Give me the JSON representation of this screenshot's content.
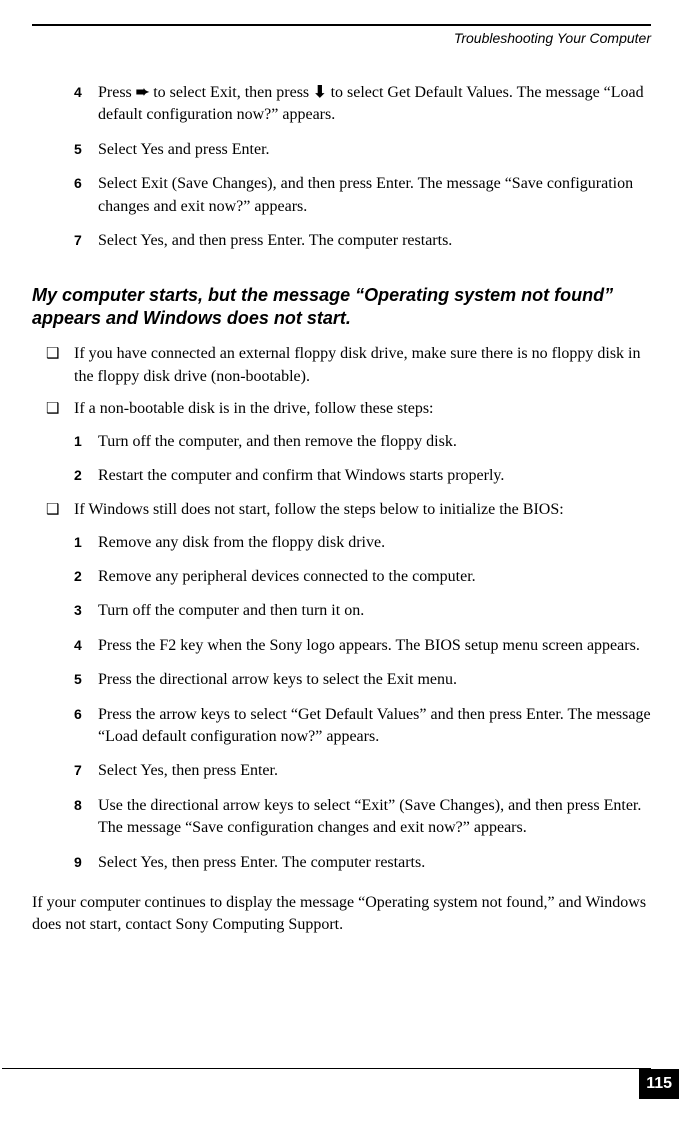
{
  "header": {
    "title": "Troubleshooting Your Computer"
  },
  "top_steps": [
    {
      "n": "4",
      "text_a": "Press ",
      "arrow1": "➨",
      "text_b": "   to select Exit, then press ",
      "arrow2": "⬇",
      "text_c": " to select Get Default Values. The message “Load default configuration now?” appears."
    },
    {
      "n": "5",
      "text": "Select Yes and press Enter."
    },
    {
      "n": "6",
      "text": "Select Exit (Save Changes), and then press Enter. The message “Save configuration changes and exit now?” appears."
    },
    {
      "n": "7",
      "text": "Select Yes, and then press Enter. The computer restarts."
    }
  ],
  "heading": "My computer starts, but the message “Operating system not found” appears and Windows does not start.",
  "bullets": [
    {
      "text": "If you have connected an external floppy disk drive, make sure there is no floppy disk in the floppy disk drive (non-bootable)."
    },
    {
      "text": "If a non-bootable disk is in the drive, follow these steps:",
      "steps": [
        {
          "n": "1",
          "text": "Turn off the computer, and then remove the floppy disk."
        },
        {
          "n": "2",
          "text": "Restart the computer and confirm that Windows starts properly."
        }
      ]
    },
    {
      "text": "If Windows still does not start, follow the steps below to initialize the BIOS:",
      "steps": [
        {
          "n": "1",
          "text": "Remove any disk from the floppy disk drive."
        },
        {
          "n": "2",
          "text": "Remove any peripheral devices connected to the computer."
        },
        {
          "n": "3",
          "text": "Turn off the computer and then turn it on."
        },
        {
          "n": "4",
          "text": "Press the F2 key when the Sony logo appears. The BIOS setup menu screen appears."
        },
        {
          "n": "5",
          "text": "Press the directional arrow keys to select the Exit menu."
        },
        {
          "n": "6",
          "text": "Press the arrow keys to select “Get Default Values” and then press Enter. The message “Load default configuration now?” appears."
        },
        {
          "n": "7",
          "text": "Select Yes, then press Enter."
        },
        {
          "n": "8",
          "text": "Use the directional arrow keys to select “Exit” (Save Changes), and then press Enter. The message “Save configuration changes and exit now?” appears."
        },
        {
          "n": "9",
          "text": "Select Yes, then press Enter. The computer restarts."
        }
      ]
    }
  ],
  "closing": "If your computer continues to display the message “Operating system not found,” and Windows does not start, contact Sony Computing Support.",
  "page_number": "115",
  "bullet_glyph": "❑"
}
